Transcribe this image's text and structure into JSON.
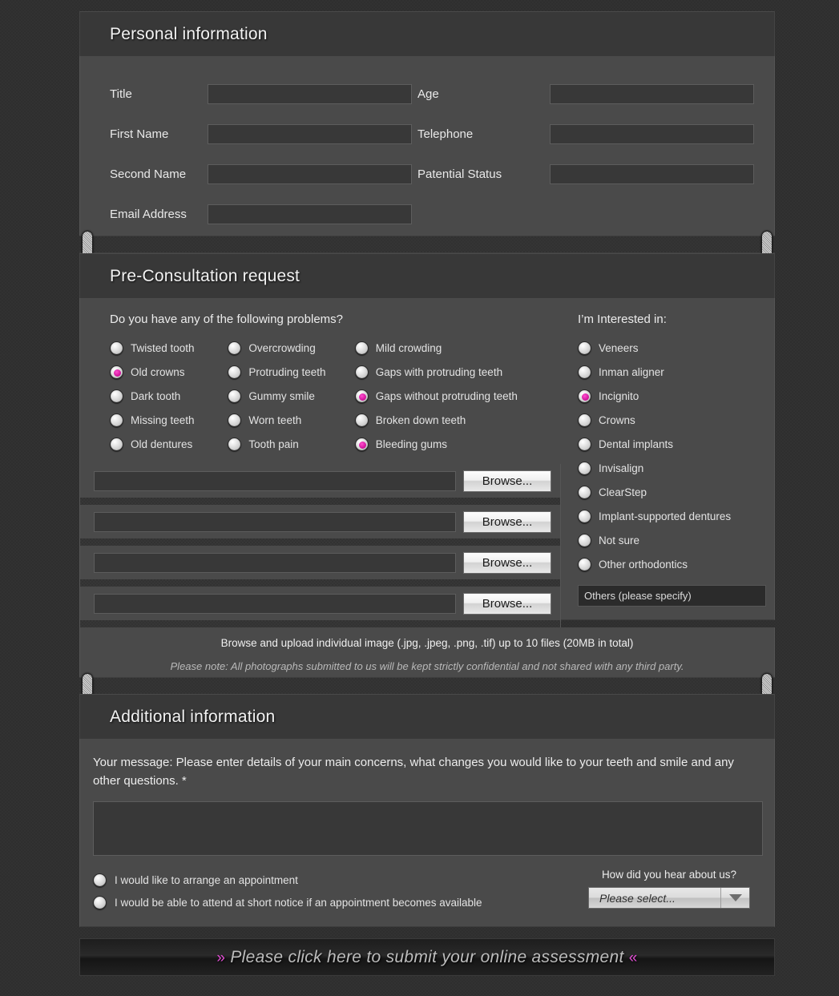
{
  "accent_color": "#d4179f",
  "panel_bg": "#4a4a4a",
  "header_bg": "#383838",
  "sections": {
    "personal": {
      "title": "Personal information",
      "left_fields": [
        {
          "label": "Title",
          "value": "",
          "placeholder": ""
        },
        {
          "label": "First Name",
          "value": "",
          "placeholder": ""
        },
        {
          "label": "Second Name",
          "value": "",
          "placeholder": ""
        },
        {
          "label": "Email Address",
          "value": "",
          "placeholder": ""
        }
      ],
      "right_fields": [
        {
          "label": "Age",
          "value": "",
          "placeholder": ""
        },
        {
          "label": "Telephone",
          "value": "",
          "placeholder": ""
        },
        {
          "label": "Patential Status",
          "value": "",
          "placeholder": ""
        }
      ]
    },
    "preconsult": {
      "title": "Pre-Consultation request",
      "question": "Do you have any of the following problems?",
      "problems_col1": [
        {
          "label": "Twisted tooth",
          "selected": false
        },
        {
          "label": "Old crowns",
          "selected": true
        },
        {
          "label": "Dark tooth",
          "selected": false
        },
        {
          "label": "Missing teeth",
          "selected": false
        },
        {
          "label": "Old dentures",
          "selected": false
        }
      ],
      "problems_col2": [
        {
          "label": "Overcrowding",
          "selected": false
        },
        {
          "label": "Protruding teeth",
          "selected": false
        },
        {
          "label": "Gummy smile",
          "selected": false
        },
        {
          "label": "Worn teeth",
          "selected": false
        },
        {
          "label": "Tooth pain",
          "selected": false
        }
      ],
      "problems_col3": [
        {
          "label": "Mild crowding",
          "selected": false
        },
        {
          "label": "Gaps with protruding teeth",
          "selected": false
        },
        {
          "label": "Gaps without protruding teeth",
          "selected": true
        },
        {
          "label": "Broken down teeth",
          "selected": false
        },
        {
          "label": "Bleeding gums",
          "selected": true
        }
      ],
      "interested_title": "I’m Interested in:",
      "interested": [
        {
          "label": "Veneers",
          "selected": false
        },
        {
          "label": "Inman aligner",
          "selected": false
        },
        {
          "label": "Incignito",
          "selected": true
        },
        {
          "label": "Crowns",
          "selected": false
        },
        {
          "label": "Dental implants",
          "selected": false
        },
        {
          "label": "Invisalign",
          "selected": false
        },
        {
          "label": "ClearStep",
          "selected": false
        },
        {
          "label": "Implant-supported dentures",
          "selected": false
        },
        {
          "label": "Not sure",
          "selected": false
        },
        {
          "label": "Other orthodontics",
          "selected": false
        }
      ],
      "others_value": "Others (please specify)",
      "others_placeholder": "Others (please specify)"
    },
    "upload": {
      "rows": [
        {
          "value": "",
          "placeholder": "",
          "button": "Browse..."
        },
        {
          "value": "",
          "placeholder": "",
          "button": "Browse..."
        },
        {
          "value": "",
          "placeholder": "",
          "button": "Browse..."
        },
        {
          "value": "",
          "placeholder": "",
          "button": "Browse..."
        }
      ],
      "note_primary": "Browse and upload individual image (.jpg, .jpeg, .png, .tif) up to 10 files (20MB in total)",
      "note_secondary": "Please note: All photographs submitted to us will be kept strictly confidential and not shared with any third party."
    },
    "additional": {
      "title": "Additional information",
      "message_label": "Your message: Please enter details of your main concerns, what changes you would like to your teeth and smile and any other questions. *",
      "message_value": "",
      "message_placeholder": "",
      "appointment_options": [
        {
          "label": "I would like to arrange an appointment",
          "selected": false
        },
        {
          "label": "I would be able to attend at short notice if an appointment becomes available",
          "selected": false
        }
      ],
      "hear_label": "How did you hear about us?",
      "hear_selected": "Please select..."
    },
    "submit": {
      "left_chevron": "»",
      "label": "Please click here to submit your online assessment",
      "right_chevron": "«"
    }
  }
}
